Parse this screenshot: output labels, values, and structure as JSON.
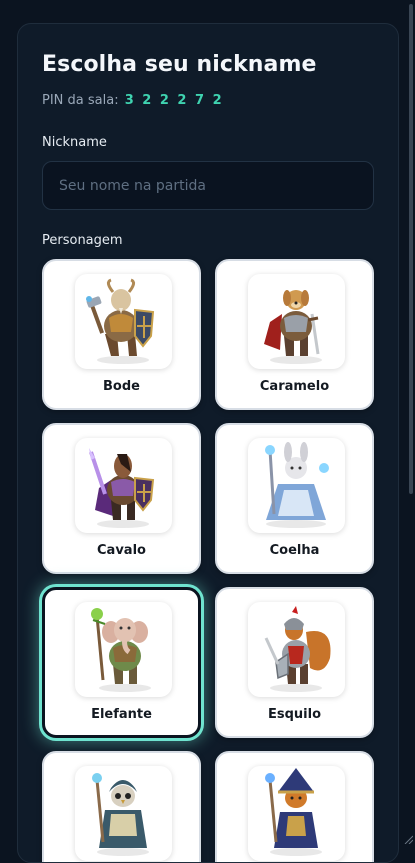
{
  "form": {
    "title": "Escolha seu nickname",
    "pin_label": "PIN da sala:",
    "pin_code": "3 2 2 2 7 2",
    "nickname_label": "Nickname",
    "nickname_placeholder": "Seu nome na partida",
    "nickname_value": "",
    "character_label": "Personagem"
  },
  "characters": [
    {
      "name": "Bode",
      "selected": false
    },
    {
      "name": "Caramelo",
      "selected": false
    },
    {
      "name": "Cavalo",
      "selected": false
    },
    {
      "name": "Coelha",
      "selected": false
    },
    {
      "name": "Elefante",
      "selected": true
    },
    {
      "name": "Esquilo",
      "selected": false
    },
    {
      "name": "",
      "selected": false
    },
    {
      "name": "",
      "selected": false
    }
  ],
  "colors": {
    "background": "#0b1420",
    "panel": "#0f1b29",
    "accent": "#3fd3b0",
    "selected_glow": "#6fe3cf"
  }
}
